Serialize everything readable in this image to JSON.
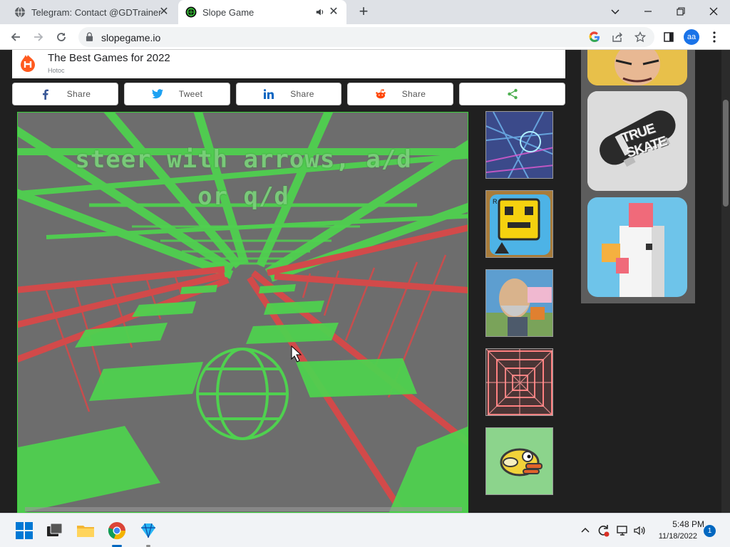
{
  "browser": {
    "tabs": [
      {
        "title": "Telegram: Contact @GDTrainer",
        "active": false
      },
      {
        "title": "Slope Game",
        "active": true
      }
    ],
    "url": "slopegame.io",
    "profile_initials": "aa"
  },
  "page": {
    "header": {
      "title": "The Best Games for 2022",
      "subtitle": "Hotoc"
    },
    "share_buttons": [
      {
        "network": "facebook",
        "label": "Share",
        "color": "#3b5998"
      },
      {
        "network": "twitter",
        "label": "Tweet",
        "color": "#1da1f2"
      },
      {
        "network": "linkedin",
        "label": "Share",
        "color": "#0a66c2"
      },
      {
        "network": "reddit",
        "label": "Share",
        "color": "#ff4500"
      },
      {
        "network": "generic",
        "label": "",
        "color": "#4caf50"
      }
    ],
    "game": {
      "overlay_text_line1": "steer with arrows, a/d",
      "overlay_text_line2": "or q/d",
      "accent_green": "#4fd14f",
      "accent_red": "#d24a4a"
    },
    "related_games": [
      {
        "name": "Slope",
        "icon": "slope-thumb"
      },
      {
        "name": "Geometry Dash",
        "icon": "geometry-dash-thumb"
      },
      {
        "name": "Happy Wheels",
        "icon": "happy-wheels-thumb"
      },
      {
        "name": "Tunnel Rush",
        "icon": "tunnel-rush-thumb"
      },
      {
        "name": "Flappy Bird",
        "icon": "flappy-bird-thumb"
      }
    ],
    "right_panel_games": [
      {
        "name": "Anime Fighter",
        "icon": "anime-thumb"
      },
      {
        "name": "True Skate",
        "icon": "true-skate-thumb",
        "logo_text": "TRUE SKATE"
      },
      {
        "name": "Crossy Road",
        "icon": "crossy-road-thumb"
      }
    ]
  },
  "taskbar": {
    "time": "5:48 PM",
    "date": "11/18/2022",
    "notification_count": "1"
  }
}
